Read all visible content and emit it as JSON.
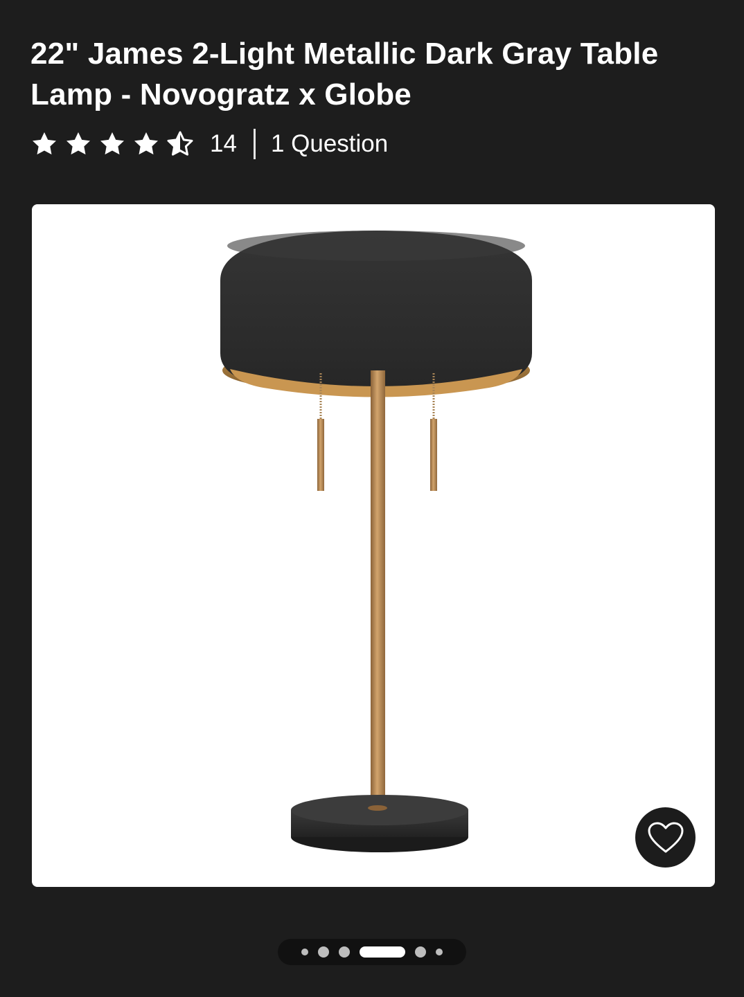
{
  "product": {
    "title": "22\" James 2-Light Metallic Dark Gray Table Lamp - Novogratz x Globe"
  },
  "rating": {
    "stars": 4.5,
    "max_stars": 5,
    "review_count": "14",
    "questions_label": "1 Question"
  },
  "gallery": {
    "image_icon": "table-lamp-product-image",
    "favorite_icon": "heart-outline-icon",
    "slide_count": 6,
    "active_slide": 4
  },
  "colors": {
    "background": "#1d1d1d",
    "card": "#ffffff",
    "lamp_shade": "#2e2e2e",
    "lamp_brass": "#b98a56"
  }
}
